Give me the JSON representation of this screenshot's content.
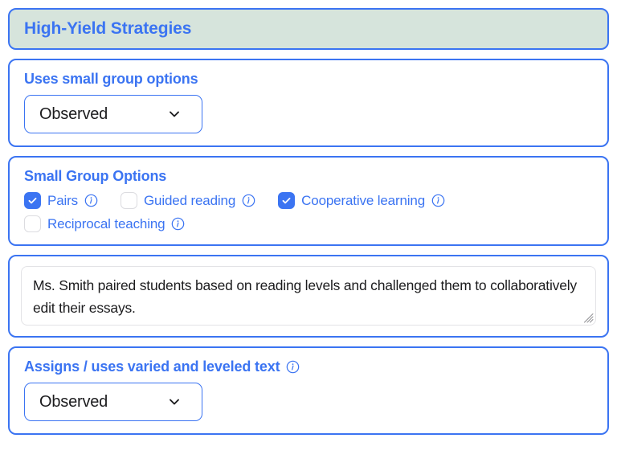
{
  "header": {
    "title": "High-Yield Strategies",
    "background_color": "#d6e4dc",
    "text_color": "#3b74f2",
    "border_color": "#3b74f2"
  },
  "accent_color": "#3b74f2",
  "sections": {
    "uses_small_group": {
      "label": "Uses small group options",
      "select": {
        "value": "Observed",
        "chevron_icon": "chevron-down-icon"
      }
    },
    "small_group_options": {
      "label": "Small Group Options",
      "info_icon": "info-icon",
      "rows": [
        [
          {
            "label": "Pairs",
            "checked": true,
            "info_icon": "info-icon"
          },
          {
            "label": "Guided reading",
            "checked": false,
            "info_icon": "info-icon"
          },
          {
            "label": "Cooperative learning",
            "checked": true,
            "info_icon": "info-icon"
          }
        ],
        [
          {
            "label": "Reciprocal teaching",
            "checked": false,
            "info_icon": "info-icon"
          }
        ]
      ]
    },
    "evidence_note": {
      "value": "Ms. Smith paired students based on reading levels and challenged them to collaboratively edit their essays.",
      "placeholder": "",
      "resize_handle_icon": "resize-handle-icon"
    },
    "varied_leveled_text": {
      "label": "Assigns / uses varied and leveled text",
      "info_icon": "info-icon",
      "select": {
        "value": "Observed",
        "chevron_icon": "chevron-down-icon"
      }
    }
  }
}
